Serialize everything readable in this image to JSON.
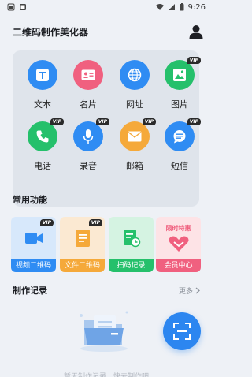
{
  "status_bar": {
    "time": "9:26"
  },
  "header": {
    "title": "二维码制作美化器"
  },
  "tools": [
    {
      "label": "文本",
      "icon": "text-icon",
      "color": "#2f8cf3",
      "vip": ""
    },
    {
      "label": "名片",
      "icon": "business-card-icon",
      "color": "#f0607f",
      "vip": ""
    },
    {
      "label": "网址",
      "icon": "globe-icon",
      "color": "#2f8cf3",
      "vip": ""
    },
    {
      "label": "图片",
      "icon": "image-icon",
      "color": "#25c06b",
      "vip": "VIP"
    },
    {
      "label": "电话",
      "icon": "phone-icon",
      "color": "#25c06b",
      "vip": "VIP"
    },
    {
      "label": "录音",
      "icon": "microphone-icon",
      "color": "#2f8cf3",
      "vip": "VIP"
    },
    {
      "label": "邮箱",
      "icon": "mail-icon",
      "color": "#f5a93a",
      "vip": "VIP"
    },
    {
      "label": "短信",
      "icon": "message-icon",
      "color": "#2f8cf3",
      "vip": "VIP"
    }
  ],
  "common": {
    "title": "常用功能",
    "items": [
      {
        "label": "视频二维码",
        "icon": "video-camera-icon",
        "bg": "#d7e8fb",
        "bar": "#2f8cf3",
        "vip": "VIP"
      },
      {
        "label": "文件二维码",
        "icon": "document-icon",
        "bg": "#fbe9d2",
        "bar": "#f5a93a",
        "vip": "VIP"
      },
      {
        "label": "扫码记录",
        "icon": "scan-history-icon",
        "bg": "#d5f3e2",
        "bar": "#25c06b",
        "vip": ""
      },
      {
        "label": "会员中心",
        "icon": "membership-heart-icon",
        "bg": "#fde3e6",
        "bar": "#f0607f",
        "vip": "",
        "badge": "限时特惠"
      }
    ]
  },
  "records": {
    "title": "制作记录",
    "more": "更多",
    "empty_text": "暂无制作记录，快去制作吧"
  },
  "colors": {
    "accent": "#2c86f0"
  }
}
